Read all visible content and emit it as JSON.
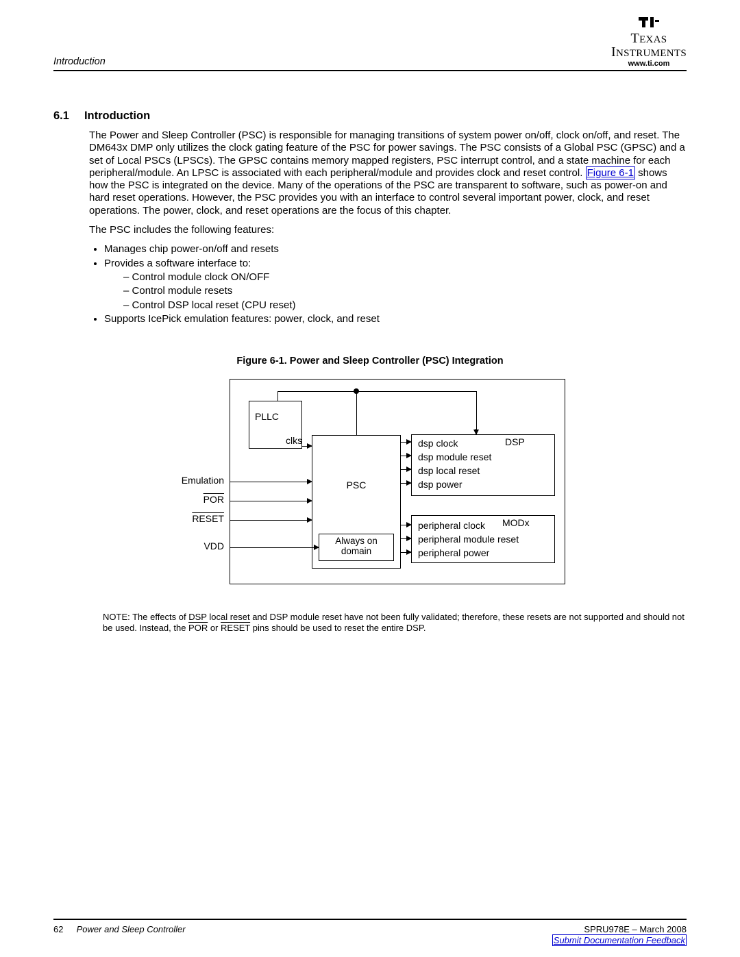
{
  "header": {
    "company_line": "TEXAS INSTRUMENTS",
    "url": "www.ti.com",
    "running_head": "Introduction"
  },
  "section": {
    "number": "6.1",
    "title": "Introduction"
  },
  "paragraphs": {
    "p1a": "The Power and Sleep Controller (PSC) is responsible for managing transitions of system power on/off, clock on/off, and reset. The DM643x DMP only utilizes the clock gating feature of the PSC for power savings. The PSC consists of a Global PSC (GPSC) and a set of Local PSCs (LPSCs). The GPSC contains memory mapped registers, PSC interrupt control, and a state machine for each peripheral/module. An LPSC is associated with each peripheral/module and provides clock and reset control. ",
    "fig_ref": "Figure 6-1",
    "p1b": " shows how the PSC is integrated on the device. Many of the operations of the PSC are transparent to software, such as power-on and hard reset operations. However, the PSC provides you with an interface to control several important power, clock, and reset operations. The power, clock, and reset operations are the focus of this chapter.",
    "p2": "The PSC includes the following features:"
  },
  "bullets": {
    "b1": "Manages chip power-on/off and resets",
    "b2": "Provides a software interface to:",
    "b2a": "Control module clock ON/OFF",
    "b2b": "Control module resets",
    "b2c": "Control DSP local reset (CPU reset)",
    "b3": "Supports IcePick emulation features: power, clock, and reset"
  },
  "figure": {
    "caption": "Figure 6-1. Power and Sleep Controller (PSC) Integration",
    "labels": {
      "pllc": "PLLC",
      "clks": "clks",
      "psc": "PSC",
      "aod1": "Always on",
      "aod2": "domain",
      "dsp": "DSP",
      "dsp_clock": "dsp clock",
      "dsp_module_reset": "dsp module reset",
      "dsp_local_reset": "dsp local reset",
      "dsp_power": "dsp power",
      "modx": "MODx",
      "periph_clock": "peripheral clock",
      "periph_module_reset": "peripheral module reset",
      "periph_power": "peripheral power",
      "emulation": "Emulation",
      "por": "POR",
      "reset": "RESET",
      "vdd": "VDD"
    }
  },
  "note": {
    "prefix": "NOTE: The effects of DSP local reset and DSP module reset have not been fully validated; therefore, these resets are not supported and should not be used. Instead, the ",
    "por": "POR",
    "mid": " or ",
    "reset": "RESET",
    "suffix": " pins should be used to reset the entire DSP."
  },
  "footer": {
    "page_number": "62",
    "chapter": "Power and Sleep Controller",
    "docid": "SPRU978E – March 2008",
    "feedback": "Submit Documentation Feedback"
  }
}
